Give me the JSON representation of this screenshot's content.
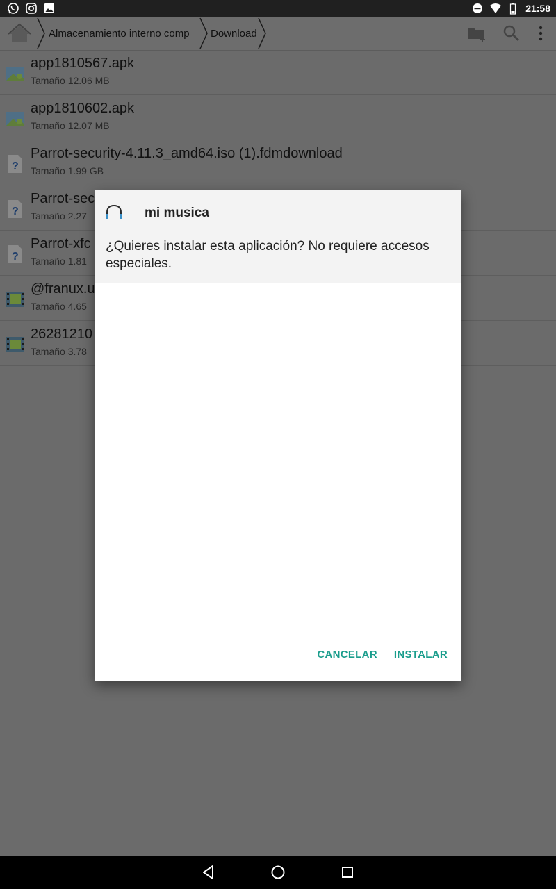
{
  "status_bar": {
    "left_icons": [
      "whatsapp-icon",
      "instagram-icon",
      "image-icon"
    ],
    "right_icons": [
      "do-not-disturb-icon",
      "wifi-icon",
      "battery-icon"
    ],
    "time": "21:58"
  },
  "toolbar": {
    "home_icon": "home-icon",
    "breadcrumb": [
      "Almacenamiento interno comp",
      "Download"
    ],
    "actions": [
      "new-folder-icon",
      "search-icon",
      "more-options-icon"
    ]
  },
  "files": [
    {
      "name": "app1810567.apk",
      "size": "Tamaño 12.06 MB",
      "icon": "apk-file-icon"
    },
    {
      "name": "app1810602.apk",
      "size": "Tamaño 12.07 MB",
      "icon": "apk-file-icon"
    },
    {
      "name": "Parrot-security-4.11.3_amd64.iso (1).fdmdownload",
      "size": "Tamaño 1.99 GB",
      "icon": "unknown-file-icon"
    },
    {
      "name": "Parrot-sec",
      "size": "Tamaño 2.27",
      "icon": "unknown-file-icon"
    },
    {
      "name": "Parrot-xfc",
      "size": "Tamaño 1.81",
      "icon": "unknown-file-icon"
    },
    {
      "name": "@franux.u",
      "size": "Tamaño 4.65",
      "icon": "video-file-icon"
    },
    {
      "name": "26281210",
      "size": "Tamaño 3.78",
      "icon": "video-file-icon"
    }
  ],
  "dialog": {
    "app_icon": "headphones-icon",
    "app_name": "mi musica",
    "message": "¿Quieres instalar esta aplicación? No requiere accesos especiales.",
    "cancel_label": "CANCELAR",
    "install_label": "INSTALAR",
    "accent": "#1a9d8c"
  },
  "nav_bar": [
    "back-icon",
    "home-circle-icon",
    "recents-icon"
  ]
}
